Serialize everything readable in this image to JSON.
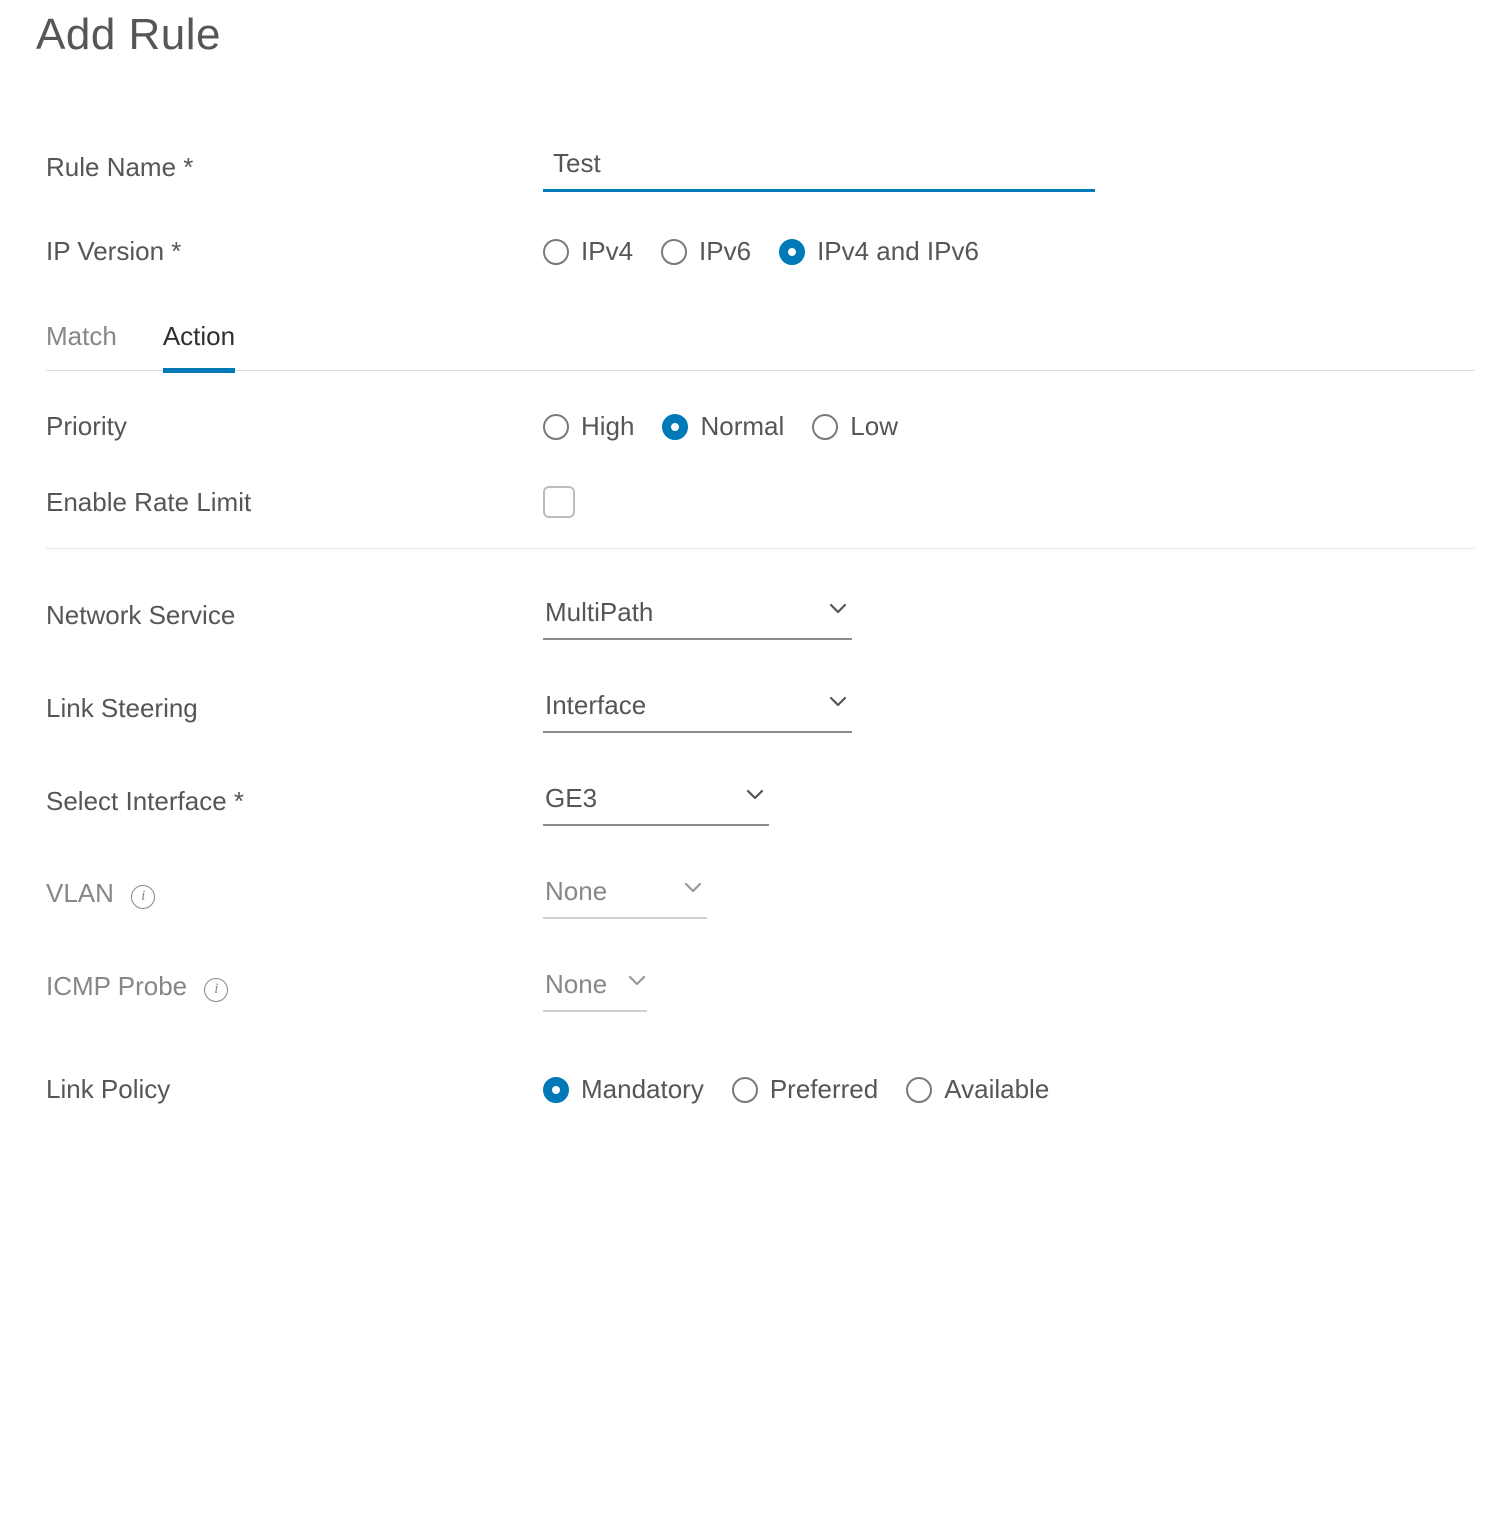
{
  "title": "Add Rule",
  "labels": {
    "rule_name": "Rule Name",
    "ip_version": "IP Version",
    "priority": "Priority",
    "enable_rate_limit": "Enable Rate Limit",
    "network_service": "Network Service",
    "link_steering": "Link Steering",
    "select_interface": "Select Interface",
    "vlan": "VLAN",
    "icmp_probe": "ICMP Probe",
    "link_policy": "Link Policy"
  },
  "values": {
    "rule_name": "Test",
    "network_service": "MultiPath",
    "link_steering": "Interface",
    "select_interface": "GE3",
    "vlan": "None",
    "icmp_probe": "None",
    "enable_rate_limit": false,
    "ip_version_selected": "both",
    "priority_selected": "normal",
    "link_policy_selected": "mandatory"
  },
  "tabs": {
    "match": "Match",
    "action": "Action",
    "active": "action"
  },
  "ip_version_options": {
    "ipv4": "IPv4",
    "ipv6": "IPv6",
    "both": "IPv4 and IPv6"
  },
  "priority_options": {
    "high": "High",
    "normal": "Normal",
    "low": "Low"
  },
  "link_policy_options": {
    "mandatory": "Mandatory",
    "preferred": "Preferred",
    "available": "Available"
  }
}
